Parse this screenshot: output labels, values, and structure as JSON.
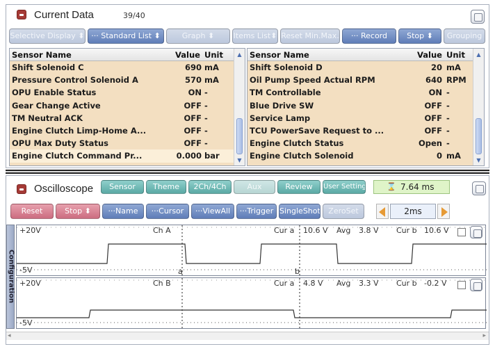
{
  "current_data": {
    "title": "Current Data",
    "count": "39/40",
    "toolbar": {
      "selective_display": "Selective Display",
      "standard_list": "Standard List",
      "graph": "Graph",
      "items_list": "Items List",
      "reset_min_max": "Reset Min.Max.",
      "record": "Record",
      "stop": "Stop",
      "grouping": "Grouping"
    },
    "columns": {
      "sensor": "Sensor Name",
      "value": "Value",
      "unit": "Unit"
    },
    "left_rows": [
      {
        "name": "Shift Solenoid C",
        "value": "690",
        "unit": "mA"
      },
      {
        "name": "Pressure Control Solenoid A",
        "value": "570",
        "unit": "mA"
      },
      {
        "name": "OPU Enable Status",
        "value": "ON",
        "unit": "-"
      },
      {
        "name": "Gear Change Active",
        "value": "OFF",
        "unit": "-"
      },
      {
        "name": "TM Neutral ACK",
        "value": "OFF",
        "unit": "-"
      },
      {
        "name": "Engine Clutch Limp-Home A...",
        "value": "OFF",
        "unit": "-"
      },
      {
        "name": "OPU Max Duty Status",
        "value": "OFF",
        "unit": "-"
      },
      {
        "name": "Engine Clutch Command Pr...",
        "value": "0.000",
        "unit": "bar"
      }
    ],
    "right_rows": [
      {
        "name": "Shift Solenoid D",
        "value": "20",
        "unit": "mA"
      },
      {
        "name": "Oil Pump Speed Actual RPM",
        "value": "640",
        "unit": "RPM"
      },
      {
        "name": "TM Controllable",
        "value": "ON",
        "unit": "-"
      },
      {
        "name": "Blue Drive SW",
        "value": "OFF",
        "unit": "-"
      },
      {
        "name": "Service Lamp",
        "value": "OFF",
        "unit": "-"
      },
      {
        "name": "TCU PowerSave Request to ...",
        "value": "OFF",
        "unit": "-"
      },
      {
        "name": "Engine Clutch Status",
        "value": "Open",
        "unit": "-"
      },
      {
        "name": "Engine Clutch Solenoid",
        "value": "0",
        "unit": "mA"
      }
    ]
  },
  "oscilloscope": {
    "title": "Oscilloscope",
    "tabs": {
      "sensor": "Sensor",
      "theme": "Theme",
      "ch": "2Ch/4Ch",
      "aux": "Aux",
      "review": "Review",
      "user_setting": "User Setting"
    },
    "time_readout": "7.64 ms",
    "controls": {
      "reset": "Reset",
      "stop": "Stop",
      "name": "Name",
      "cursor": "Cursor",
      "view_all": "ViewAll",
      "trigger": "Trigger",
      "single_shot": "SingleShot",
      "zero_set": "ZeroSet",
      "time_div": "2ms"
    },
    "side_label": "Configuration",
    "channels": [
      {
        "name": "Ch A",
        "top": "+20V",
        "bottom": "-5V",
        "cur_a_label": "Cur a",
        "cur_a": "10.6 V",
        "avg_label": "Avg",
        "avg": "3.8 V",
        "cur_b_label": "Cur b",
        "cur_b": "10.6 V",
        "marker_a": "a",
        "marker_b": "b"
      },
      {
        "name": "Ch B",
        "top": "+20V",
        "bottom": "-5V",
        "cur_a_label": "Cur a",
        "cur_a": "4.8 V",
        "avg_label": "Avg",
        "avg": "3.3 V",
        "cur_b_label": "Cur b",
        "cur_b": "-0.2 V"
      }
    ]
  },
  "colors": {
    "table_bg": "#f3dfc1",
    "button_blue": "#6f8cc4",
    "button_teal": "#72bdb8",
    "button_red": "#d67f91",
    "readout_green": "#dff4c8"
  }
}
